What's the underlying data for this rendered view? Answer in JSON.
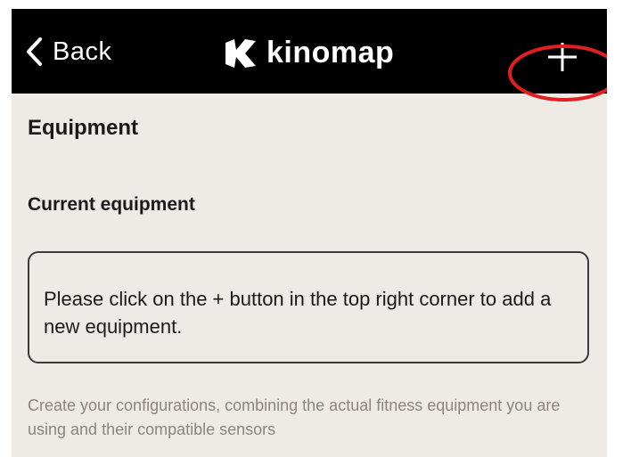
{
  "header": {
    "back_label": "Back",
    "logo_text": "kinomap",
    "add_symbol": "+"
  },
  "main": {
    "section_title": "Equipment",
    "subsection_title": "Current equipment",
    "info_message": "Please click on the + button in the top right corner to add a new equipment.",
    "helper_text": "Create your configurations, combining the actual fitness equipment you are using and their compatible sensors"
  },
  "icons": {
    "back": "chevron-left-icon",
    "logo": "kinomap-logo-icon",
    "add": "plus-icon"
  },
  "colors": {
    "header_bg": "#000000",
    "screen_bg": "#eeeae6",
    "text": "#1a1a1a",
    "helper_text": "#8a8580",
    "highlight": "#e02020"
  }
}
